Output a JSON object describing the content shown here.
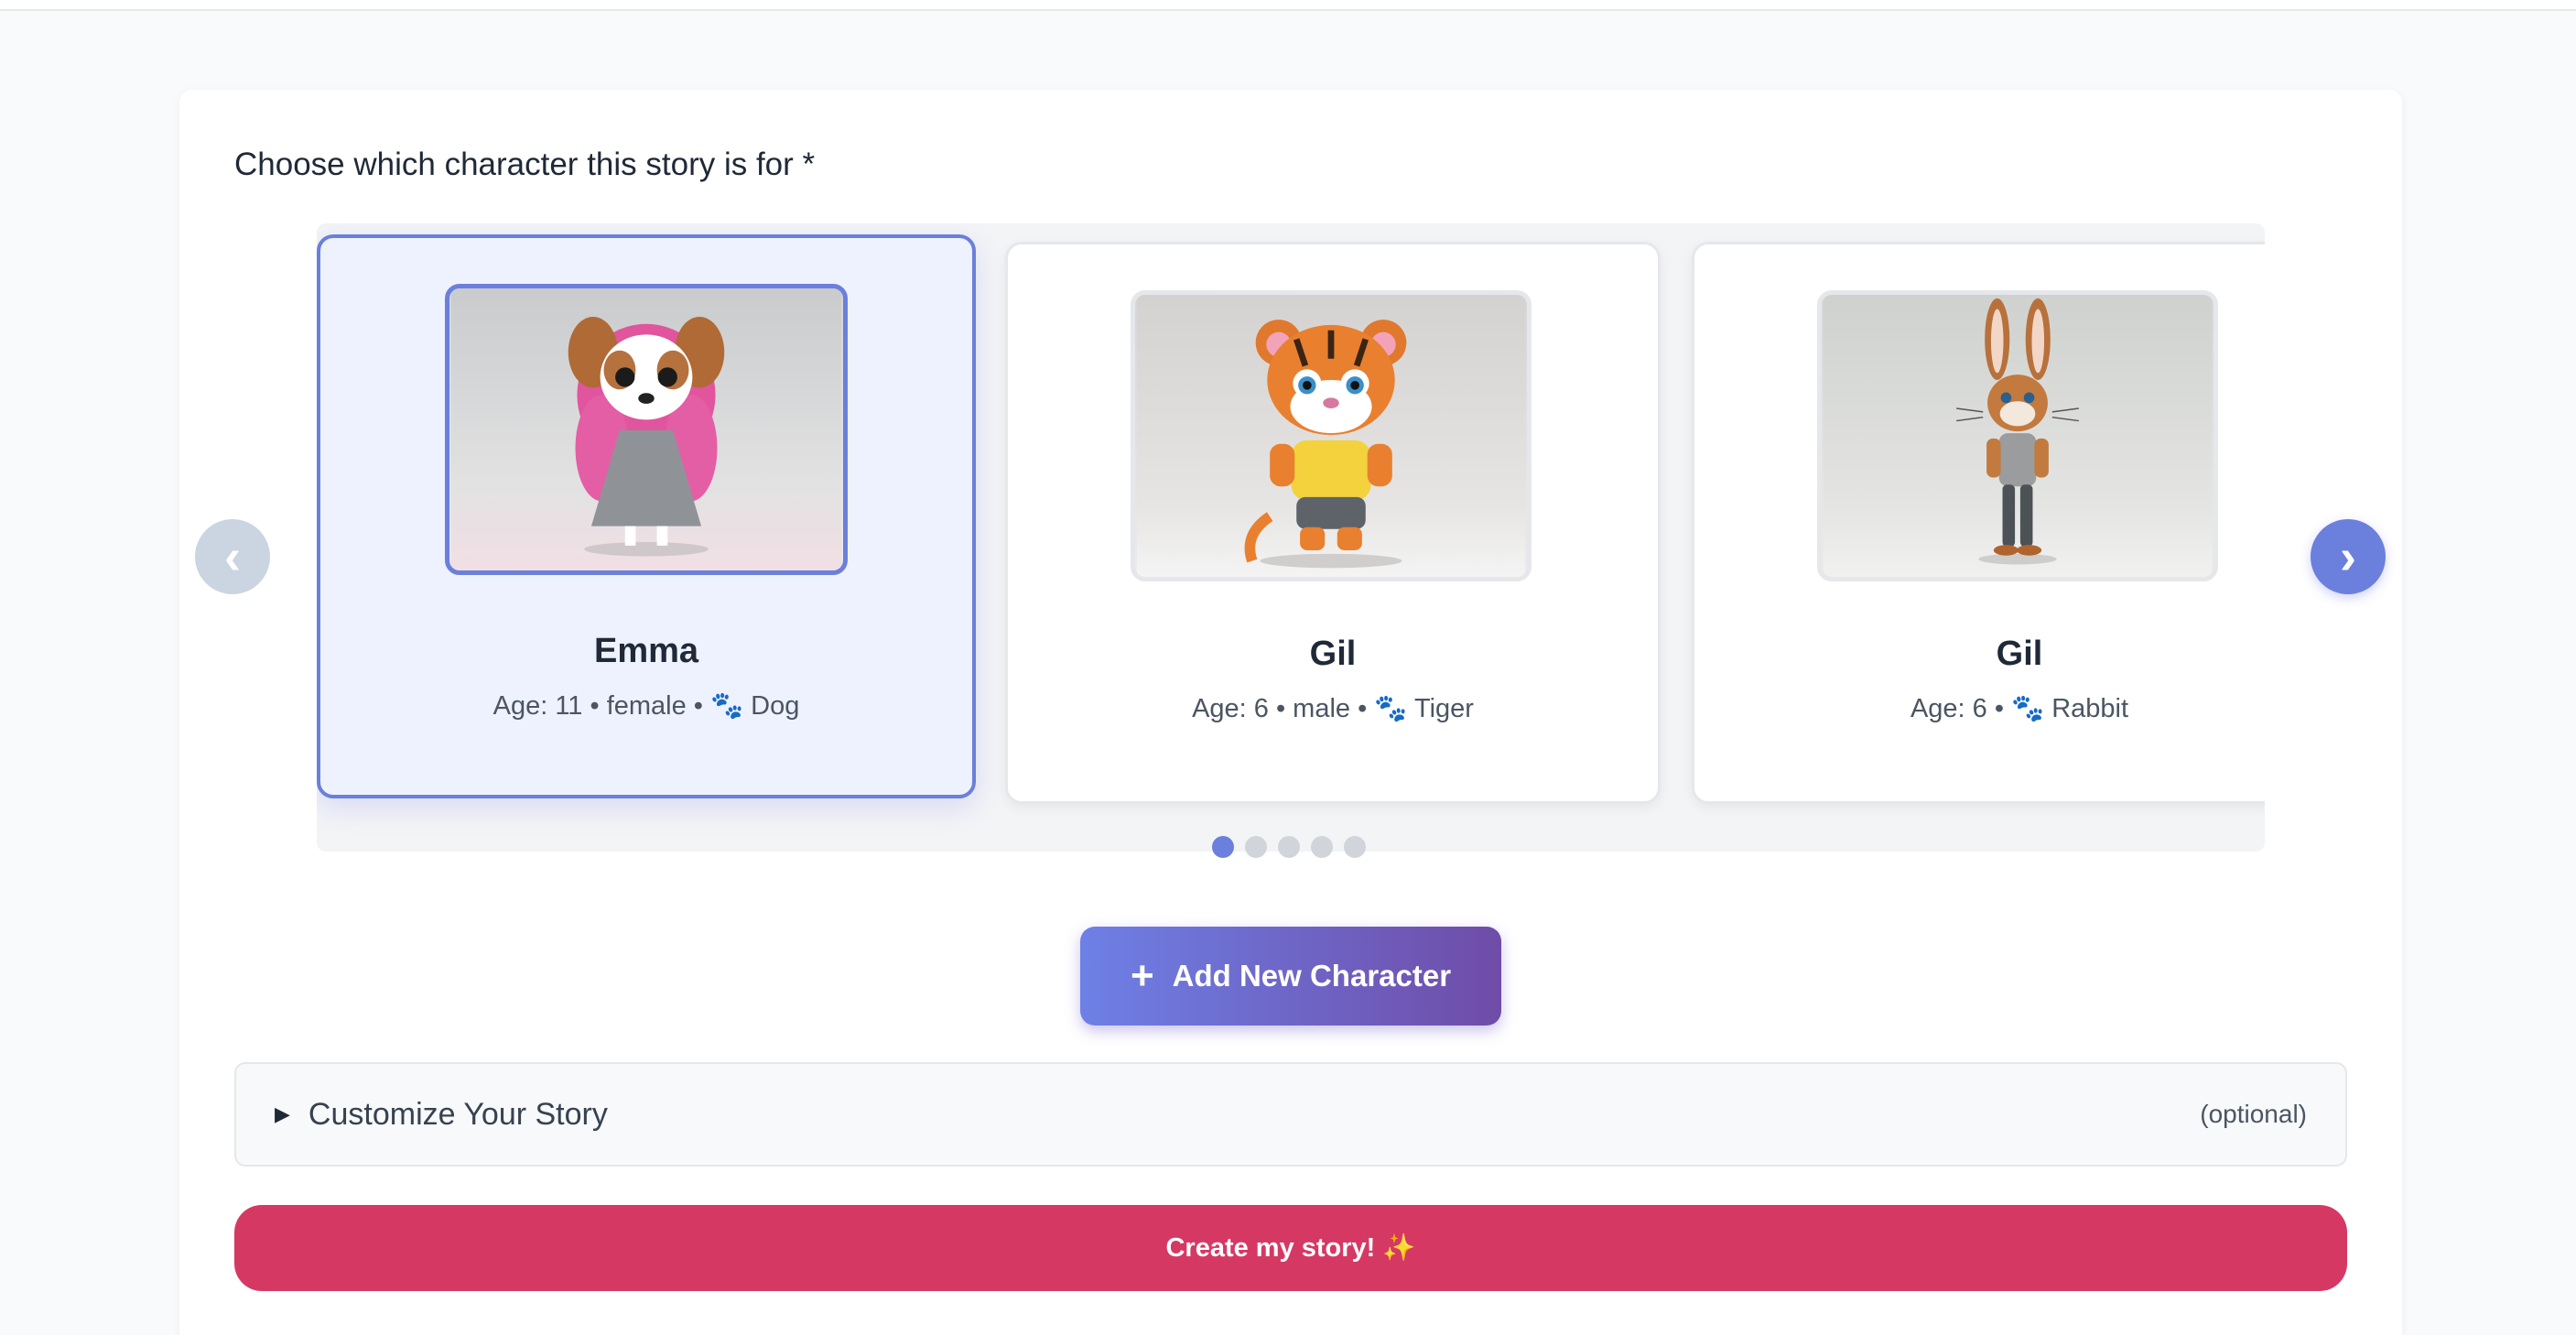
{
  "form": {
    "character_prompt": "Choose which character this story is for *"
  },
  "carousel": {
    "prev_label": "‹",
    "next_label": "›",
    "cards": [
      {
        "name": "Emma",
        "meta": "Age: 11 • female • 🐾 Dog",
        "selected": true,
        "animal": "dog"
      },
      {
        "name": "Gil",
        "meta": "Age: 6 • male • 🐾 Tiger",
        "selected": false,
        "animal": "tiger"
      },
      {
        "name": "Gil",
        "meta": "Age: 6 • 🐾 Rabbit",
        "selected": false,
        "animal": "rabbit"
      }
    ],
    "page_count": 5,
    "active_page": 1
  },
  "actions": {
    "add_plus": "+",
    "add_label": "Add New Character",
    "create_label": "Create my story! ✨"
  },
  "customize": {
    "toggle_icon": "▶",
    "label": "Customize Your Story",
    "optional": "(optional)"
  },
  "colors": {
    "accent": "#6b7fdc",
    "create_button": "#d63864",
    "add_gradient_start": "#6e80e6",
    "add_gradient_end": "#6f4ca8"
  }
}
